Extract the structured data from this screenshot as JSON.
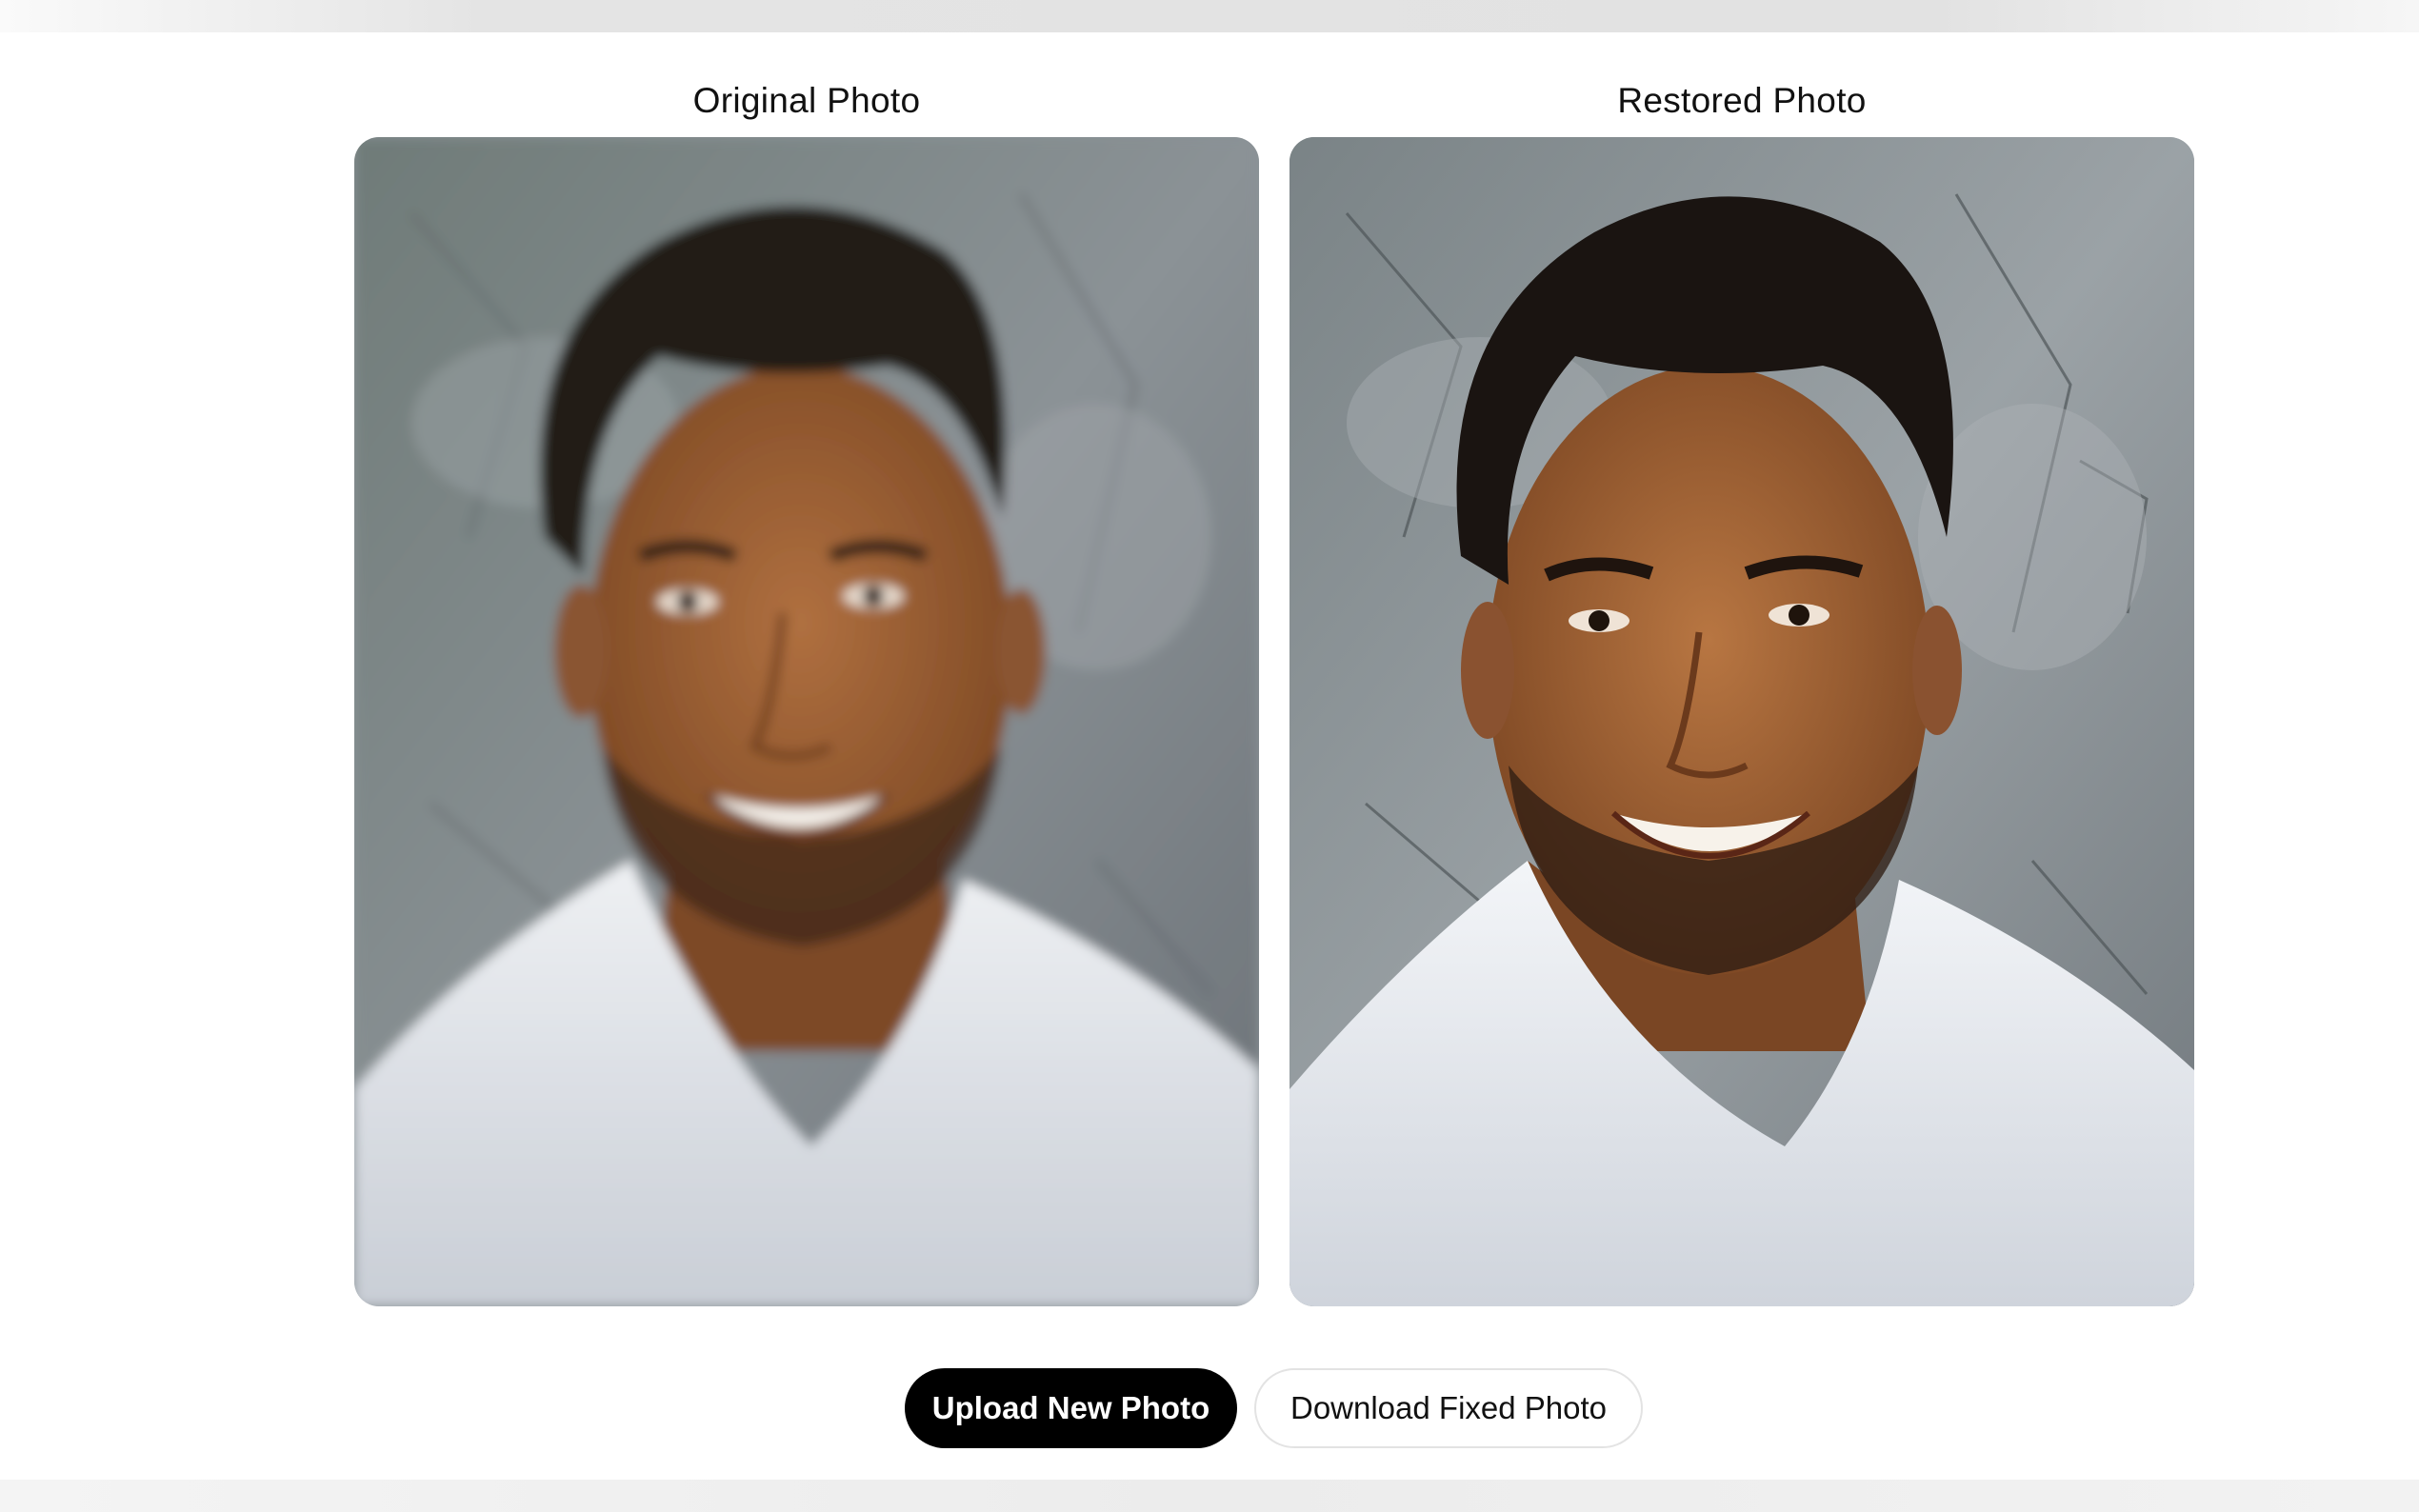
{
  "panels": {
    "original": {
      "label": "Original Photo"
    },
    "restored": {
      "label": "Restored Photo"
    }
  },
  "actions": {
    "upload_label": "Upload New Photo",
    "download_label": "Download Fixed Photo"
  },
  "colors": {
    "primary_button_bg": "#000000",
    "primary_button_text": "#ffffff",
    "secondary_button_border": "#e3e3e3",
    "background": "#ffffff"
  }
}
